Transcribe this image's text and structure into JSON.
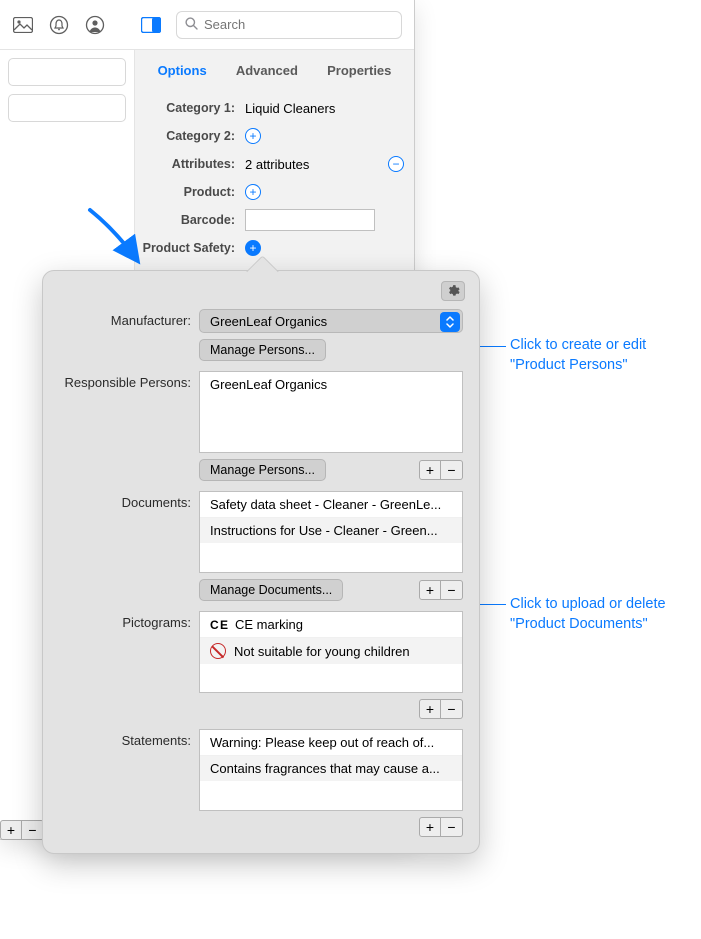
{
  "toolbar": {
    "search_placeholder": "Search"
  },
  "tabs": {
    "options": "Options",
    "advanced": "Advanced",
    "properties": "Properties"
  },
  "form": {
    "category1_label": "Category 1:",
    "category1_value": "Liquid Cleaners",
    "category2_label": "Category 2:",
    "attributes_label": "Attributes:",
    "attributes_value": "2 attributes",
    "product_label": "Product:",
    "barcode_label": "Barcode:",
    "barcode_value": "",
    "safety_label": "Product Safety:"
  },
  "popover": {
    "manufacturer_label": "Manufacturer:",
    "manufacturer_value": "GreenLeaf Organics",
    "manage_persons_label": "Manage Persons...",
    "responsible_label": "Responsible Persons:",
    "responsible_items": [
      "GreenLeaf Organics"
    ],
    "documents_label": "Documents:",
    "documents_items": [
      "Safety data sheet - Cleaner - GreenLe...",
      "Instructions for Use - Cleaner - Green..."
    ],
    "manage_documents_label": "Manage Documents...",
    "pictograms_label": "Pictograms:",
    "pictograms_items": [
      "CE marking",
      "Not suitable for young children"
    ],
    "statements_label": "Statements:",
    "statements_items": [
      "Warning: Please keep out of reach of...",
      "Contains fragrances that may cause a..."
    ]
  },
  "callouts": {
    "c1": "Click to create or edit \"Product Persons\"",
    "c2": "Click to upload or delete \"Product Documents\""
  }
}
